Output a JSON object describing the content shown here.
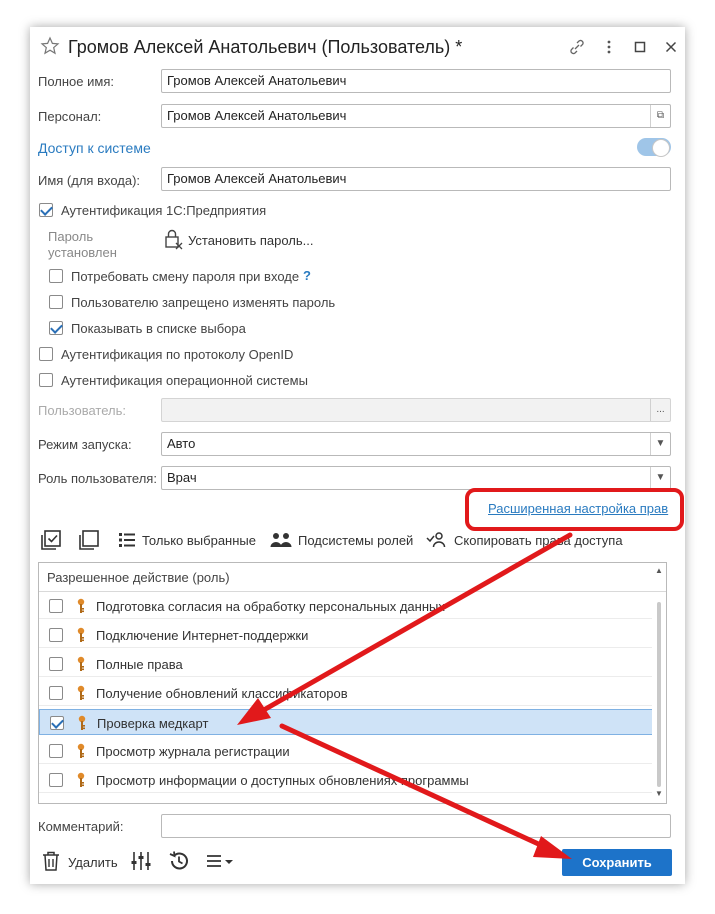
{
  "window": {
    "title": "Громов Алексей Анатольевич (Пользователь) *",
    "icons": [
      "star-icon",
      "link-icon",
      "more-icon",
      "maximize-icon",
      "close-icon"
    ]
  },
  "form": {
    "full_name": {
      "label": "Полное имя:",
      "value": "Громов Алексей Анатольевич"
    },
    "personnel": {
      "label": "Персонал:",
      "value": "Громов Алексей Анатольевич"
    },
    "system_access": {
      "label": "Доступ к системе",
      "enabled": true
    },
    "login": {
      "label": "Имя (для входа):",
      "value": "Громов Алексей Анатольевич"
    },
    "auth_1c": {
      "label": "Аутентификация 1С:Предприятия",
      "checked": true
    },
    "password": {
      "status": "Пароль установлен",
      "set_button": "Установить пароль..."
    },
    "require_change": {
      "label": "Потребовать смену пароля при входе",
      "help": "?",
      "checked": false
    },
    "forbid_change": {
      "label": "Пользователю запрещено изменять пароль",
      "checked": false
    },
    "show_in_list": {
      "label": "Показывать в списке выбора",
      "checked": true
    },
    "auth_openid": {
      "label": "Аутентификация по протоколу OpenID",
      "checked": false
    },
    "auth_os": {
      "label": "Аутентификация операционной системы",
      "checked": false
    },
    "os_user": {
      "label": "Пользователь:",
      "value": "",
      "button": "..."
    },
    "launch_mode": {
      "label": "Режим запуска:",
      "value": "Авто"
    },
    "user_role": {
      "label": "Роль пользователя:",
      "value": "Врач"
    },
    "advanced_rights": "Расширенная настройка прав"
  },
  "toolbar": {
    "only_selected": "Только выбранные",
    "role_subsystems": "Подсистемы ролей",
    "copy_rights": "Скопировать права доступа"
  },
  "roles_list": {
    "header": "Разрешенное действие (роль)",
    "rows": [
      {
        "label": "Подготовка согласия на обработку персональных данных",
        "checked": false,
        "selected": false
      },
      {
        "label": "Подключение Интернет-поддержки",
        "checked": false,
        "selected": false
      },
      {
        "label": "Полные права",
        "checked": false,
        "selected": false
      },
      {
        "label": "Получение обновлений классификаторов",
        "checked": false,
        "selected": false
      },
      {
        "label": "Проверка медкарт",
        "checked": true,
        "selected": true
      },
      {
        "label": "Просмотр журнала регистрации",
        "checked": false,
        "selected": false
      },
      {
        "label": "Просмотр информации о доступных обновлениях программы",
        "checked": false,
        "selected": false
      }
    ]
  },
  "comment": {
    "label": "Комментарий:",
    "value": ""
  },
  "bottom": {
    "delete": "Удалить",
    "save": "Сохранить"
  },
  "colors": {
    "accent": "#1d73c9",
    "link": "#2a7bc0",
    "annotation": "#e1191b",
    "selection": "#cfe3f7"
  }
}
